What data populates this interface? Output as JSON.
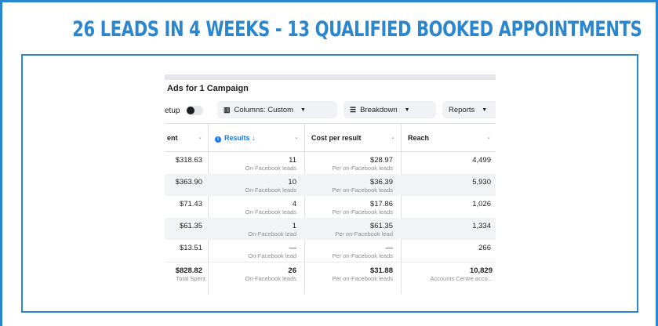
{
  "headline": "26 LEADS IN 4 WEEKS - 13 QUALIFIED BOOKED APPOINTMENTS",
  "colors": {
    "accent": "#2a86cf",
    "results_blue": "#1877f2"
  },
  "screenshot": {
    "title": "Ads for 1 Campaign",
    "toolbar": {
      "setup_label": "etup",
      "setup_toggle": "toggle-icon",
      "columns_label": "Columns: Custom",
      "columns_icon": "columns-icon",
      "breakdown_label": "Breakdown",
      "breakdown_icon": "breakdown-icon",
      "reports_label": "Reports"
    },
    "headers": {
      "spent": "ent",
      "results": "Results ↓",
      "cost": "Cost per result",
      "reach": "Reach"
    },
    "rows": [
      {
        "spent": "$318.63",
        "results": "11",
        "results_sub": "On-Facebook leads",
        "cost": "$28.97",
        "cost_sub": "Per on-Facebook leads",
        "reach": "4,499"
      },
      {
        "spent": "$363.90",
        "results": "10",
        "results_sub": "On-Facebook leads",
        "cost": "$36.39",
        "cost_sub": "Per on-Facebook leads",
        "reach": "5,930"
      },
      {
        "spent": "$71.43",
        "results": "4",
        "results_sub": "On-Facebook leads",
        "cost": "$17.86",
        "cost_sub": "Per on-Facebook leads",
        "reach": "1,026"
      },
      {
        "spent": "$61.35",
        "results": "1",
        "results_sub": "On-Facebook lead",
        "cost": "$61.35",
        "cost_sub": "Per on-Facebook lead",
        "reach": "1,334"
      },
      {
        "spent": "$13.51",
        "results": "—",
        "results_sub": "On-Facebook lead",
        "cost": "—",
        "cost_sub": "Per on-Facebook leads",
        "reach": "266"
      }
    ],
    "totals": {
      "spent": "$828.82",
      "spent_sub": "Total Spent",
      "results": "26",
      "results_sub": "On-Facebook leads",
      "cost": "$31.88",
      "cost_sub": "Per on-Facebook leads",
      "reach": "10,829",
      "reach_sub": "Accounts Centre acco..."
    }
  }
}
